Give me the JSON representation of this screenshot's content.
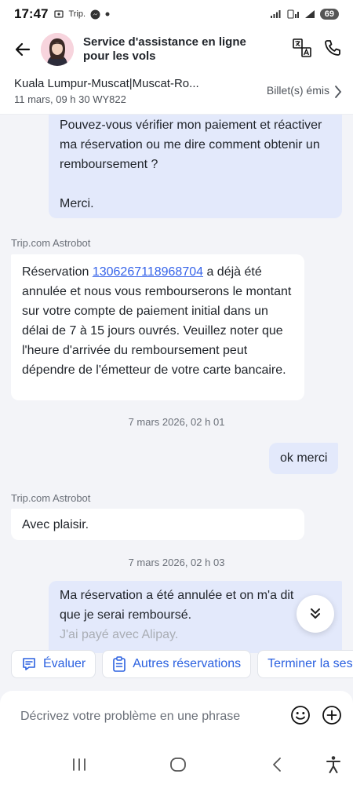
{
  "status_bar": {
    "time": "17:47",
    "carrier": "Trip.",
    "battery": "69"
  },
  "header": {
    "title": "Service d'assistance en ligne pour les vols"
  },
  "trip": {
    "route": "Kuala Lumpur-Muscat|Muscat-Ro...",
    "details": "11 mars, 09 h 30 WY822",
    "status": "Billet(s) émis"
  },
  "messages": {
    "user_1": {
      "para1": "Pouvez-vous vérifier mon paiement et réactiver ma réservation ou me dire comment obtenir un remboursement ?",
      "para2": "Merci."
    },
    "bot_1": {
      "sender": "Trip.com Astrobot",
      "prefix": "Réservation ",
      "booking_number": "1306267118968704",
      "suffix": " a déjà été annulée et nous vous rembourserons le montant sur votre compte de paiement initial dans un délai de 7 à 15 jours ouvrés. Veuillez noter que l'heure d'arrivée du remboursement peut dépendre de l'émetteur de votre carte bancaire."
    },
    "timestamp_1": "7 mars 2026, 02 h 01",
    "user_2": "ok merci",
    "bot_2": {
      "sender": "Trip.com Astrobot",
      "text": "Avec plaisir."
    },
    "timestamp_2": "7 mars 2026, 02 h 03",
    "user_3": {
      "line1": "Ma réservation a été annulée et on m'a dit",
      "line2": "que je serai remboursé.",
      "line3": "J'ai payé avec Alipay."
    }
  },
  "quick_actions": [
    {
      "label": "Évaluer",
      "icon": "comment-icon"
    },
    {
      "label": "Autres réservations",
      "icon": "clipboard-icon"
    },
    {
      "label": "Terminer la session",
      "icon": ""
    }
  ],
  "composer": {
    "placeholder": "Décrivez votre problème en une phrase"
  },
  "colors": {
    "accent": "#2b61e0",
    "user_bubble": "#e3e9fb",
    "link": "#3563e9"
  }
}
